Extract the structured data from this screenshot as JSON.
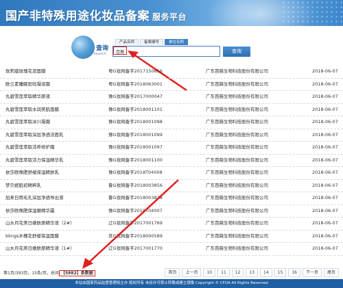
{
  "header": {
    "title": "国产非特殊用途化妆品备案",
    "subtitle": "服务平台"
  },
  "search": {
    "label": "查询",
    "label_en": "Search",
    "tabs": [
      "产品名称",
      "备案编号",
      "单位名称"
    ],
    "active_tab": 2,
    "value": "芭薇",
    "button": "查询"
  },
  "rows": [
    {
      "name": "玫莉蔻玫瑰花泥面膜",
      "code": "粤G妆网备字2017150656",
      "company": "广东芭薇生物科技股份有限公司",
      "date": "2018-06-07"
    },
    {
      "name": "欧兰素睡眠密码凝润霜",
      "code": "粤G妆网备字2018063001",
      "company": "广东芭薇生物科技股份有限公司",
      "date": "2018-06-07"
    },
    {
      "name": "丸碧雪莲萃取精华原液",
      "code": "豫G妆网备字2017000047",
      "company": "广东芭薇生物科技股份有限公司",
      "date": "2018-06-07"
    },
    {
      "name": "丸碧雪莲萃取水润美肌面膜",
      "code": "豫G妆网备字2018001101",
      "company": "广东芭薇生物科技股份有限公司",
      "date": "2018-06-07"
    },
    {
      "name": "丸碧雪莲萃取冰川凝霜",
      "code": "豫G妆网备字2018001098",
      "company": "广东芭薇生物科技股份有限公司",
      "date": "2018-06-07"
    },
    {
      "name": "丸碧雪莲萃取深层净透洁面乳",
      "code": "豫G妆网备字2018001099",
      "company": "广东芭薇生物科技股份有限公司",
      "date": "2018-06-07"
    },
    {
      "name": "丸碧雪莲萃取活养修护霜",
      "code": "豫G妆网备字2018001097",
      "company": "广东芭薇生物科技股份有限公司",
      "date": "2018-06-07"
    },
    {
      "name": "丸碧雪莲萃取活力保湿精华乳",
      "code": "豫G妆网备字2018001100",
      "company": "广东芭薇生物科技股份有限公司",
      "date": "2018-06-07"
    },
    {
      "name": "依莎欧豫肥舒缓保湿精肤乳",
      "code": "豫G妆网备字2018T04008",
      "company": "广东芭薇生物科技股份有限公司",
      "date": "2018-06-07"
    },
    {
      "name": "梦贝妮肌初精粹乳",
      "code": "鲁G妆网备字2018003856",
      "company": "广东芭薇生物科技股份有限公司",
      "date": "2018-06-07"
    },
    {
      "name": "加来日用毛孔深层净透导出液",
      "code": "鲁G妆网备字2018003838",
      "company": "广东芭薇生物科技股份有限公司",
      "date": "2018-06-07"
    },
    {
      "name": "依莎欧豫肥保湿嫩精华露",
      "code": "豫G妆网备字2018T04007",
      "company": "广东芭薇生物科技股份有限公司",
      "date": "2018-06-07"
    },
    {
      "name": "山水月花美日嫩肤原精华液（2#）",
      "code": "辽G妆网备字2017001769",
      "company": "广东芭薇生物科技股份有限公司",
      "date": "2018-06-07"
    },
    {
      "name": "blings木槿花舒缓保湿面膜",
      "code": "苏G妆网备字2018000589",
      "company": "广东芭薇生物科技股份有限公司",
      "date": "2018-06-07"
    },
    {
      "name": "山水月花美日嫩肤原精华液（1#）",
      "code": "辽G妆网备字2017001770",
      "company": "广东芭薇生物科技股份有限公司",
      "date": "2018-06-07"
    }
  ],
  "pager": {
    "info_prefix": "第1页/393页，15条/页，总共",
    "total": "【5882】条数据",
    "links": [
      "首页",
      "上一页",
      "10",
      "11",
      "12",
      "13",
      "14",
      "15",
      "16",
      "下一页",
      "尾页"
    ],
    "current": "1"
  },
  "footer": {
    "text": "本站由国家药品监督管理局主办 版权所有 未经许可禁止转载或建立镜像 Copyright © CFDA All Rights Reserved"
  },
  "colors": {
    "header": "#3a84c8",
    "accent": "#3e7fc1",
    "highlight": "#e02020",
    "footer": "#1f5fa3"
  }
}
